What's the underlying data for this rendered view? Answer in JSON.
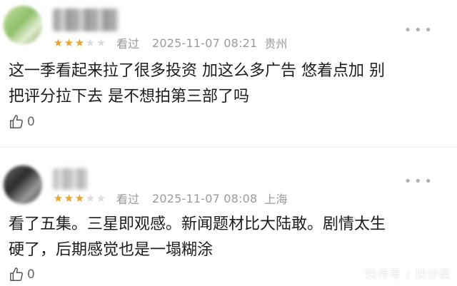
{
  "comments": [
    {
      "stars_on": 3,
      "stars_total": 5,
      "status": "看过",
      "datetime": "2025-11-07 08:21",
      "location": "贵州",
      "lines": [
        "这一季看起来拉了很多投资  加这么多广告  悠着点加 别",
        "把评分拉下去 是不想拍第三部了吗"
      ],
      "likes": "0"
    },
    {
      "stars_on": 3,
      "stars_total": 5,
      "status": "看过",
      "datetime": "2025-11-07 08:08",
      "location": "上海",
      "lines": [
        "看了五集。三星即观感。新闻题材比大陆敢。剧情太生",
        "硬了，后期感觉也是一塌糊涂"
      ],
      "likes": "0"
    }
  ],
  "icons": {
    "more": "more-dots-icon",
    "like": "thumb-up-icon",
    "star": "star-icon"
  },
  "colors": {
    "star_on": "#e6a334",
    "star_off": "#dcdcdc",
    "meta": "#9a9a9a"
  },
  "watermark": "快传号 / 扶汐梁"
}
